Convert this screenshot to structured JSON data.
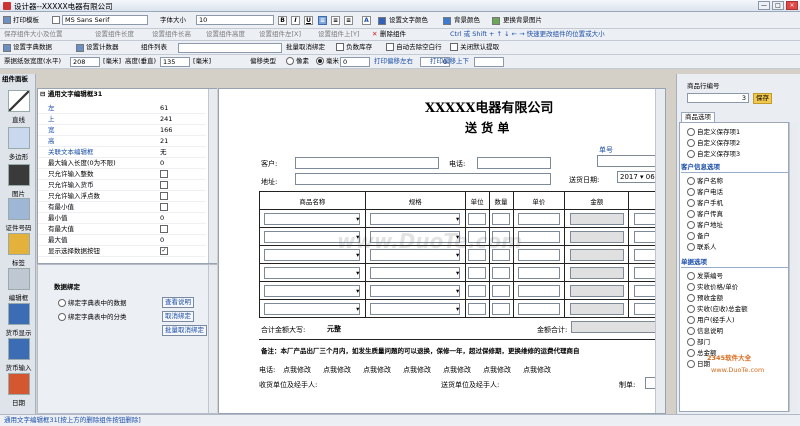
{
  "window": {
    "title": "设计器--XXXXX电器有限公司",
    "min": "—",
    "max": "□",
    "close": "×"
  },
  "toolbar1": {
    "print_template": "打印模板",
    "font_name": "MS Sans Serif",
    "font_size_label": "字体大小",
    "font_size": "10",
    "bold": "B",
    "italic": "I",
    "underline": "U",
    "align_left": "≡",
    "align_center": "≡",
    "align_right": "≡",
    "font_style": "A",
    "text_color": "设置文字颜色",
    "bg_color": "背景颜色",
    "bg_image": "更换背景图片"
  },
  "toolbar2": {
    "items": [
      "保存组件大小及位置",
      "设置组件长度",
      "设置组件长高",
      "设置组件高度",
      "设置组件左[X]",
      "设置组件上[Y]",
      "删除组件"
    ],
    "hint": "Ctrl 或 Shift + ↑ ↓ ← →  快速更改组件的位置或大小"
  },
  "toolbar3": {
    "dict_data": "设置字典数据",
    "counter": "设置计数器",
    "component_list": "组件列表",
    "batch_unbind": "批量取消绑定",
    "neg_stock": "负数库存",
    "auto_wrap": "自动去除空白行",
    "close_default": "关闭默认提取"
  },
  "toolbar4": {
    "paper_width_label": "票据纸张宽度(水平)",
    "paper_width": "208",
    "unit_mm": "[毫米]",
    "paper_height_label": "高度(垂直)",
    "paper_height": "135",
    "offset_type_label": "偏移类型",
    "pixel": "像素",
    "mm": "毫米",
    "print_offset_lr": "打印偏移左右",
    "offset_lr": "0",
    "print_offset_ud": "打印偏移上下",
    "offset_ud": "0"
  },
  "left_panel": {
    "header": "组件面板",
    "tools": [
      "直线",
      "多边形",
      "图片",
      "证件号码",
      "标签",
      "编辑框",
      "货币显示",
      "货币输入",
      "日期"
    ]
  },
  "properties": {
    "group_title": "通用文字编辑框31",
    "rows": [
      {
        "k": "左",
        "v": "61"
      },
      {
        "k": "上",
        "v": "241"
      },
      {
        "k": "宽",
        "v": "166"
      },
      {
        "k": "高",
        "v": "21"
      },
      {
        "k": "关联文本编辑框",
        "v": "无"
      },
      {
        "k": "最大输入长度(0为不限)",
        "v": "0"
      },
      {
        "k": "只允许输入整数",
        "v": ""
      },
      {
        "k": "只允许输入货币",
        "v": ""
      },
      {
        "k": "只允许输入浮点数",
        "v": ""
      },
      {
        "k": "有最小值",
        "v": ""
      },
      {
        "k": "最小值",
        "v": "0"
      },
      {
        "k": "有最大值",
        "v": ""
      },
      {
        "k": "最大值",
        "v": "0"
      },
      {
        "k": "显示选择数据按钮",
        "v": "✓"
      }
    ]
  },
  "binding": {
    "title": "数据绑定",
    "opt1": "绑定字典表中的数据",
    "opt2": "绑定字典表中的分类",
    "view_btn": "查看说明",
    "unbind_btn": "取消绑定",
    "batch_unbind_btn": "批量取消绑定"
  },
  "document": {
    "company": "XXXXX电器有限公司",
    "title": "送 货 单",
    "doc_no_label": "单号",
    "client_label": "客户:",
    "phone_label": "电话:",
    "address_label": "地址:",
    "date_label": "送货日期:",
    "date_year": "2017",
    "date_rest": "06",
    "columns": [
      "商品名称",
      "规格",
      "单位",
      "数量",
      "单价",
      "金额"
    ],
    "total_upper_label": "合计金额大写:",
    "total_upper_value": "元整",
    "total_label": "金额合计:",
    "note": "备注：本厂产品出厂三个月内，如发生质量问题的可以退换，保修一年，超过保修期，更换维修的运费代理商自",
    "phone_row_label": "电话:",
    "phone_row_items": [
      "点我修改",
      "点我修改",
      "点我修改",
      "点我修改",
      "点我修改",
      "点我修改",
      "点我修改"
    ],
    "receiver_label": "收货单位及经手人:",
    "sender_label": "送货单位及经手人:",
    "maker_label": "制单:"
  },
  "right_panel": {
    "row_no_label": "商品行编号",
    "row_no_value": "3",
    "save": "保存",
    "tab": "商品选项",
    "custom_items": [
      "自定义保存项1",
      "自定义保存项2",
      "自定义保存项3"
    ],
    "section_client": "客户信息选项",
    "client_items": [
      "客户名称",
      "客户电话",
      "客户手机",
      "客户传真",
      "客户地址",
      "备户",
      "联系人"
    ],
    "section_doc": "单据选项",
    "doc_items": [
      "发票编号",
      "实收价格/单价",
      "预收金额",
      "实收(应收)总金额",
      "用户(经手人)",
      "信息说明",
      "部门",
      "总金额",
      "日期"
    ]
  },
  "watermarks": {
    "center": "www.DuoTe.com",
    "corner_brand": "2345软件大全",
    "corner_url": "www.DuoTe.com"
  },
  "statusbar": {
    "text": "通用文字编辑框31[按上方的删除组件按钮删除]"
  }
}
